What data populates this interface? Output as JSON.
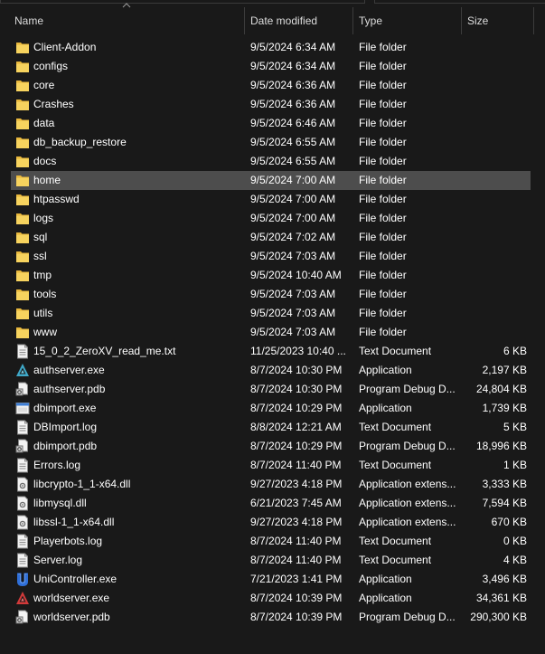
{
  "columns": {
    "name": "Name",
    "date": "Date modified",
    "type": "Type",
    "size": "Size"
  },
  "colors": {
    "folder": "#f3c94f",
    "selected": "#4d4d4d",
    "background": "#191919"
  },
  "files": [
    {
      "name": "Client-Addon",
      "date": "9/5/2024 6:34 AM",
      "type": "File folder",
      "size": "",
      "icon": "folder-icon"
    },
    {
      "name": "configs",
      "date": "9/5/2024 6:34 AM",
      "type": "File folder",
      "size": "",
      "icon": "folder-icon"
    },
    {
      "name": "core",
      "date": "9/5/2024 6:36 AM",
      "type": "File folder",
      "size": "",
      "icon": "folder-icon"
    },
    {
      "name": "Crashes",
      "date": "9/5/2024 6:36 AM",
      "type": "File folder",
      "size": "",
      "icon": "folder-icon"
    },
    {
      "name": "data",
      "date": "9/5/2024 6:46 AM",
      "type": "File folder",
      "size": "",
      "icon": "folder-icon"
    },
    {
      "name": "db_backup_restore",
      "date": "9/5/2024 6:55 AM",
      "type": "File folder",
      "size": "",
      "icon": "folder-icon"
    },
    {
      "name": "docs",
      "date": "9/5/2024 6:55 AM",
      "type": "File folder",
      "size": "",
      "icon": "folder-icon"
    },
    {
      "name": "home",
      "date": "9/5/2024 7:00 AM",
      "type": "File folder",
      "size": "",
      "icon": "folder-icon",
      "selected": true
    },
    {
      "name": "htpasswd",
      "date": "9/5/2024 7:00 AM",
      "type": "File folder",
      "size": "",
      "icon": "folder-icon"
    },
    {
      "name": "logs",
      "date": "9/5/2024 7:00 AM",
      "type": "File folder",
      "size": "",
      "icon": "folder-icon"
    },
    {
      "name": "sql",
      "date": "9/5/2024 7:02 AM",
      "type": "File folder",
      "size": "",
      "icon": "folder-icon"
    },
    {
      "name": "ssl",
      "date": "9/5/2024 7:03 AM",
      "type": "File folder",
      "size": "",
      "icon": "folder-icon"
    },
    {
      "name": "tmp",
      "date": "9/5/2024 10:40 AM",
      "type": "File folder",
      "size": "",
      "icon": "folder-icon"
    },
    {
      "name": "tools",
      "date": "9/5/2024 7:03 AM",
      "type": "File folder",
      "size": "",
      "icon": "folder-icon"
    },
    {
      "name": "utils",
      "date": "9/5/2024 7:03 AM",
      "type": "File folder",
      "size": "",
      "icon": "folder-icon"
    },
    {
      "name": "www",
      "date": "9/5/2024 7:03 AM",
      "type": "File folder",
      "size": "",
      "icon": "folder-icon"
    },
    {
      "name": "15_0_2_ZeroXV_read_me.txt",
      "date": "11/25/2023 10:40 ...",
      "type": "Text Document",
      "size": "6 KB",
      "icon": "text-document-icon"
    },
    {
      "name": "authserver.exe",
      "date": "8/7/2024 10:30 PM",
      "type": "Application",
      "size": "2,197 KB",
      "icon": "authserver-app-icon"
    },
    {
      "name": "authserver.pdb",
      "date": "8/7/2024 10:30 PM",
      "type": "Program Debug D...",
      "size": "24,804 KB",
      "icon": "debug-file-icon"
    },
    {
      "name": "dbimport.exe",
      "date": "8/7/2024 10:29 PM",
      "type": "Application",
      "size": "1,739 KB",
      "icon": "generic-app-icon"
    },
    {
      "name": "DBImport.log",
      "date": "8/8/2024 12:21 AM",
      "type": "Text Document",
      "size": "5 KB",
      "icon": "text-document-icon"
    },
    {
      "name": "dbimport.pdb",
      "date": "8/7/2024 10:29 PM",
      "type": "Program Debug D...",
      "size": "18,996 KB",
      "icon": "debug-file-icon"
    },
    {
      "name": "Errors.log",
      "date": "8/7/2024 11:40 PM",
      "type": "Text Document",
      "size": "1 KB",
      "icon": "text-document-icon"
    },
    {
      "name": "libcrypto-1_1-x64.dll",
      "date": "9/27/2023 4:18 PM",
      "type": "Application extens...",
      "size": "3,333 KB",
      "icon": "dll-file-icon"
    },
    {
      "name": "libmysql.dll",
      "date": "6/21/2023 7:45 AM",
      "type": "Application extens...",
      "size": "7,594 KB",
      "icon": "dll-file-icon"
    },
    {
      "name": "libssl-1_1-x64.dll",
      "date": "9/27/2023 4:18 PM",
      "type": "Application extens...",
      "size": "670 KB",
      "icon": "dll-file-icon"
    },
    {
      "name": "Playerbots.log",
      "date": "8/7/2024 11:40 PM",
      "type": "Text Document",
      "size": "0 KB",
      "icon": "text-document-icon"
    },
    {
      "name": "Server.log",
      "date": "8/7/2024 11:40 PM",
      "type": "Text Document",
      "size": "4 KB",
      "icon": "text-document-icon"
    },
    {
      "name": "UniController.exe",
      "date": "7/21/2023 1:41 PM",
      "type": "Application",
      "size": "3,496 KB",
      "icon": "unicontroller-app-icon"
    },
    {
      "name": "worldserver.exe",
      "date": "8/7/2024 10:39 PM",
      "type": "Application",
      "size": "34,361 KB",
      "icon": "worldserver-app-icon"
    },
    {
      "name": "worldserver.pdb",
      "date": "8/7/2024 10:39 PM",
      "type": "Program Debug D...",
      "size": "290,300 KB",
      "icon": "debug-file-icon"
    }
  ]
}
